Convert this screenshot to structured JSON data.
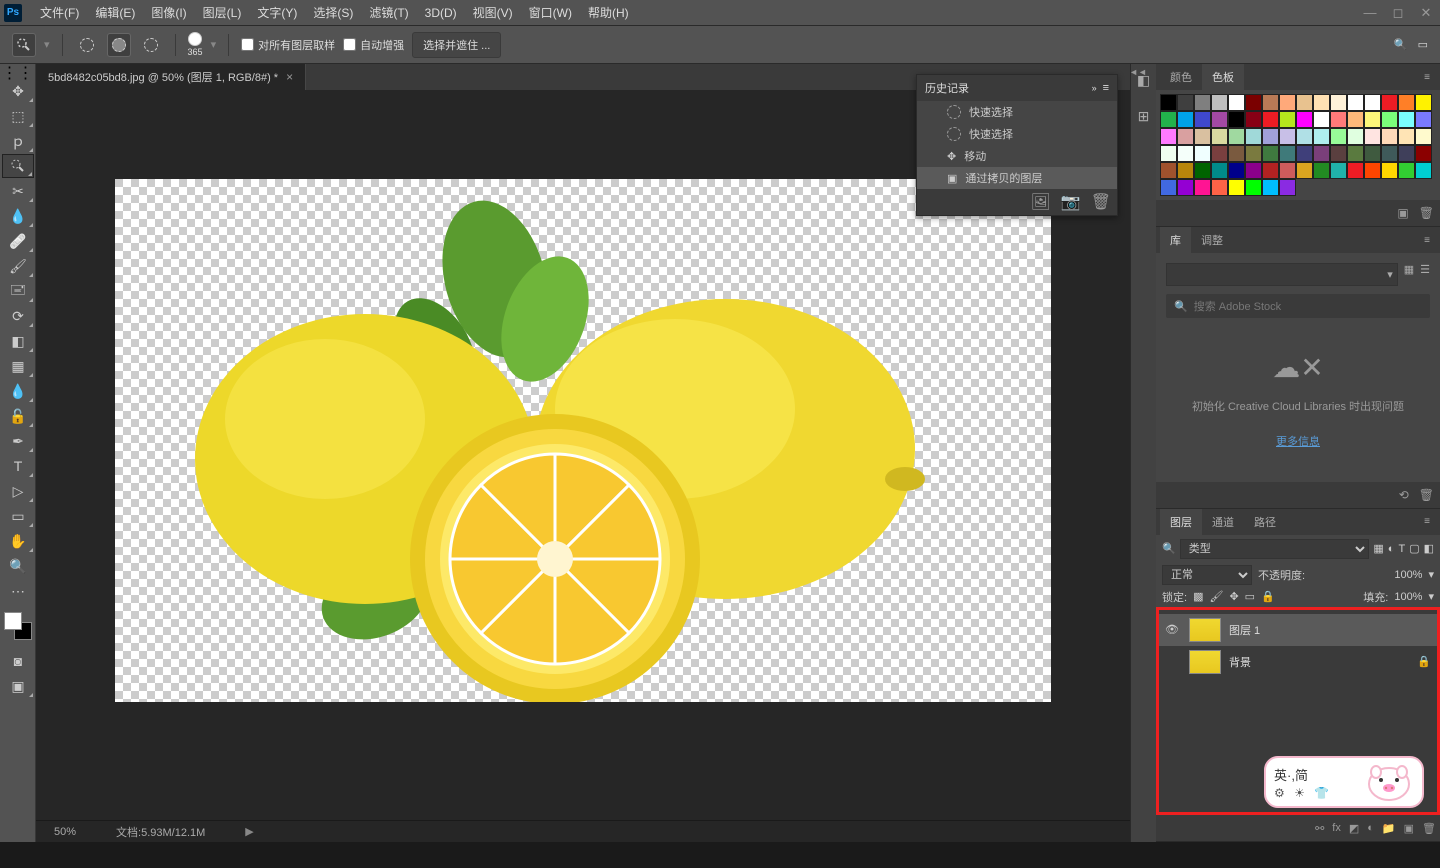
{
  "menu": {
    "items": [
      "文件(F)",
      "编辑(E)",
      "图像(I)",
      "图层(L)",
      "文字(Y)",
      "选择(S)",
      "滤镜(T)",
      "3D(D)",
      "视图(V)",
      "窗口(W)",
      "帮助(H)"
    ]
  },
  "options": {
    "brush_size": "365",
    "sample_all": "对所有图层取样",
    "auto_enhance": "自动增强",
    "select_mask_btn": "选择并遮住 ..."
  },
  "document": {
    "tab_title": "5bd8482c05bd8.jpg @ 50% (图层 1, RGB/8#) *"
  },
  "history": {
    "title": "历史记录",
    "items": [
      "快速选择",
      "快速选择",
      "移动",
      "通过拷贝的图层"
    ]
  },
  "color_panel": {
    "tabs": [
      "颜色",
      "色板"
    ]
  },
  "swatches": [
    "#000000",
    "#3f3f3f",
    "#7f7f7f",
    "#bfbfbf",
    "#ffffff",
    "#7a0000",
    "#b97a56",
    "#ffa97a",
    "#e8c28f",
    "#ffe1b3",
    "#fff2d9",
    "#ffffff",
    "#ffffff",
    "#ed1c24",
    "#ff7f27",
    "#fff200",
    "#22b14c",
    "#00a2e8",
    "#3f48cc",
    "#a349a4",
    "#000000",
    "#880015",
    "#ed1c24",
    "#b5e61d",
    "#ff00ff",
    "#ffffff",
    "#ff7a7a",
    "#ffb97a",
    "#fff77a",
    "#7aff7a",
    "#7affff",
    "#7a7aff",
    "#ff7aff",
    "#d9a0a0",
    "#d9c0a0",
    "#d9d9a0",
    "#a0d9a0",
    "#a0d9d9",
    "#a0a0d9",
    "#c8bfe7",
    "#b0e0e6",
    "#afeeee",
    "#98fb98",
    "#e0ffe0",
    "#ffe4e1",
    "#ffdab9",
    "#ffe4b5",
    "#fffacd",
    "#f0fff0",
    "#f5fffa",
    "#f0ffff",
    "#7a3f3f",
    "#7a5a3f",
    "#7a7a3f",
    "#3f7a3f",
    "#3f7a7a",
    "#3f3f7a",
    "#7a3f7a",
    "#5a3f3f",
    "#5a7a3f",
    "#3f5a3f",
    "#3f5a5a",
    "#3f3f5a",
    "#8b0000",
    "#a0522d",
    "#b8860b",
    "#006400",
    "#008b8b",
    "#00008b",
    "#8b008b",
    "#b22222",
    "#cd5c5c",
    "#daa520",
    "#228b22",
    "#20b2aa",
    "#ed1c24",
    "#ff4500",
    "#ffd700",
    "#32cd32",
    "#00ced1",
    "#4169e1",
    "#9400d3",
    "#ff1493",
    "#ff6347",
    "#ffff00",
    "#00ff00",
    "#00bfff",
    "#8a2be2"
  ],
  "libraries": {
    "tabs": [
      "库",
      "调整"
    ],
    "search_placeholder": "搜索 Adobe Stock",
    "message": "初始化 Creative Cloud Libraries 时出现问题",
    "link": "更多信息"
  },
  "layers": {
    "tabs": [
      "图层",
      "通道",
      "路径"
    ],
    "type_label": "类型",
    "blend_mode": "正常",
    "opacity_label": "不透明度:",
    "opacity_value": "100%",
    "lock_label": "锁定:",
    "fill_label": "填充:",
    "fill_value": "100%",
    "items": [
      {
        "name": "图层 1",
        "visible": true,
        "selected": true,
        "locked": false
      },
      {
        "name": "背景",
        "visible": false,
        "selected": false,
        "locked": true
      }
    ]
  },
  "status": {
    "zoom": "50%",
    "doc_info": "文档:5.93M/12.1M"
  },
  "pig": {
    "text": "英·,简",
    "icons": "⚙ ☀ 👕"
  }
}
